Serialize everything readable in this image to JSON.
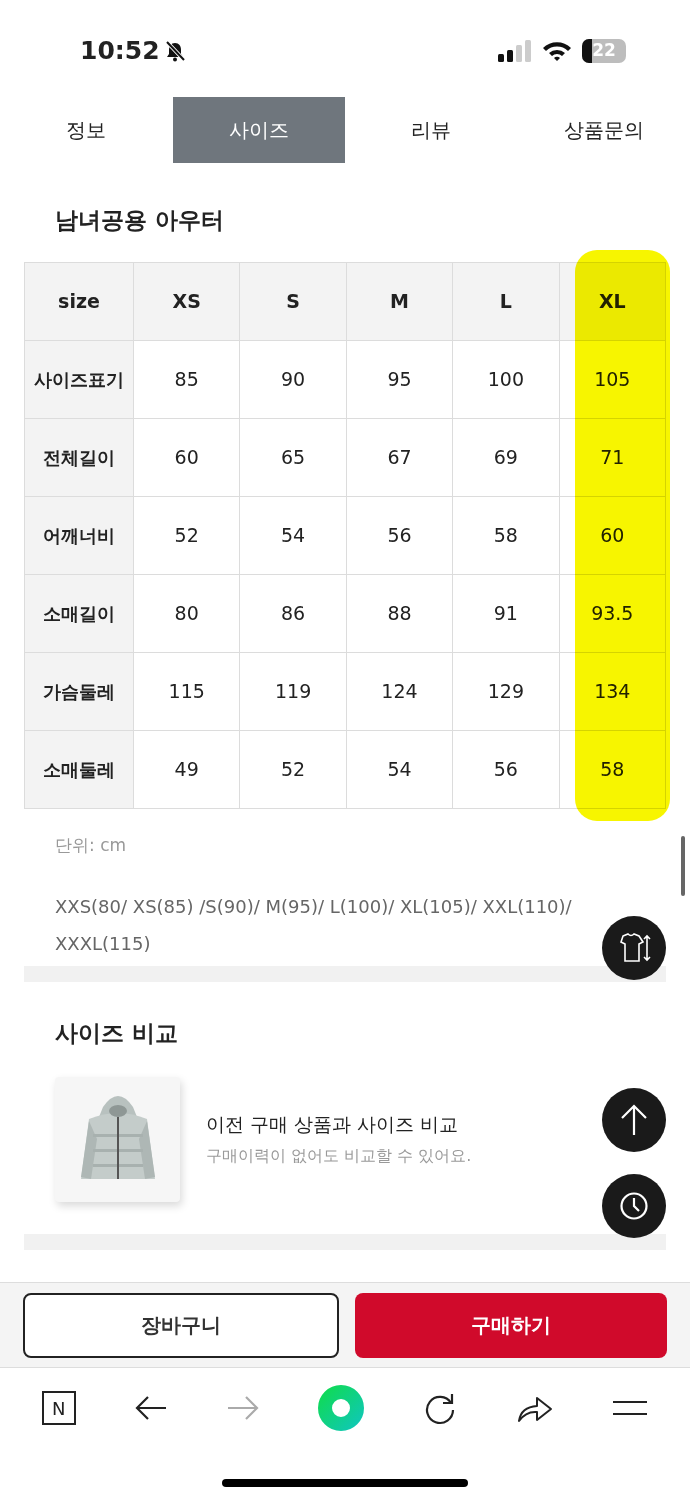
{
  "status_bar": {
    "time": "10:52",
    "battery": "22",
    "silent": true
  },
  "tabs": [
    {
      "label": "정보",
      "selected": false
    },
    {
      "label": "사이즈",
      "selected": true
    },
    {
      "label": "리뷰",
      "selected": false
    },
    {
      "label": "상품문의",
      "selected": false
    }
  ],
  "title": "남녀공용 아우터",
  "table": {
    "columns": [
      {
        "label": "size",
        "highlighted": false
      },
      {
        "label": "XS",
        "highlighted": false
      },
      {
        "label": "S",
        "highlighted": false
      },
      {
        "label": "M",
        "highlighted": false
      },
      {
        "label": "L",
        "highlighted": false
      },
      {
        "label": "XL",
        "highlighted": true
      }
    ],
    "rows": [
      [
        "사이즈표기",
        "85",
        "90",
        "95",
        "100",
        "105"
      ],
      [
        "전체길이",
        "60",
        "65",
        "67",
        "69",
        "71"
      ],
      [
        "어깨너비",
        "52",
        "54",
        "56",
        "58",
        "60"
      ],
      [
        "소매길이",
        "80",
        "86",
        "88",
        "91",
        "93.5"
      ],
      [
        "가슴둘레",
        "115",
        "119",
        "124",
        "129",
        "134"
      ],
      [
        "소매둘레",
        "49",
        "52",
        "54",
        "56",
        "58"
      ]
    ]
  },
  "unit_note": "단위: cm",
  "size_note": "XXS(80/ XS(85) /S(90)/ M(95)/ L(100)/ XL(105)/ XXL(110)/ XXXL(115)",
  "compare": {
    "title": "사이즈 비교",
    "card_title": "이전 구매 상품과 사이즈 비교",
    "card_subtitle": "구매이력이 없어도 비교할 수 있어요."
  },
  "actions": [
    {
      "label": "장바구니",
      "kind": "outline"
    },
    {
      "label": "구매하기",
      "kind": "primary"
    }
  ],
  "browser_bar": {
    "logo": "N",
    "items": [
      {
        "kind": "back",
        "disabled": false
      },
      {
        "kind": "forward",
        "disabled": true
      },
      {
        "kind": "home",
        "disabled": false
      },
      {
        "kind": "reload",
        "disabled": false
      },
      {
        "kind": "share",
        "disabled": false
      },
      {
        "kind": "menu",
        "disabled": false
      }
    ]
  }
}
